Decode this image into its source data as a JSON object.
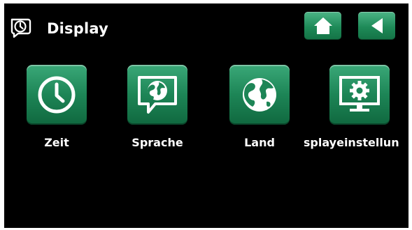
{
  "header": {
    "title": "Display",
    "title_icon": "display-settings-icon",
    "home_icon": "home-icon",
    "back_icon": "back-arrow-icon"
  },
  "menu": {
    "items": [
      {
        "label": "Zeit",
        "icon": "clock-icon"
      },
      {
        "label": "Sprache",
        "icon": "language-globe-icon"
      },
      {
        "label": "Land",
        "icon": "globe-icon"
      },
      {
        "label": "isplayeinstellun",
        "icon": "monitor-gear-icon"
      }
    ]
  },
  "colors": {
    "background": "#000000",
    "tile_green": "#1d8556",
    "text": "#ffffff"
  }
}
